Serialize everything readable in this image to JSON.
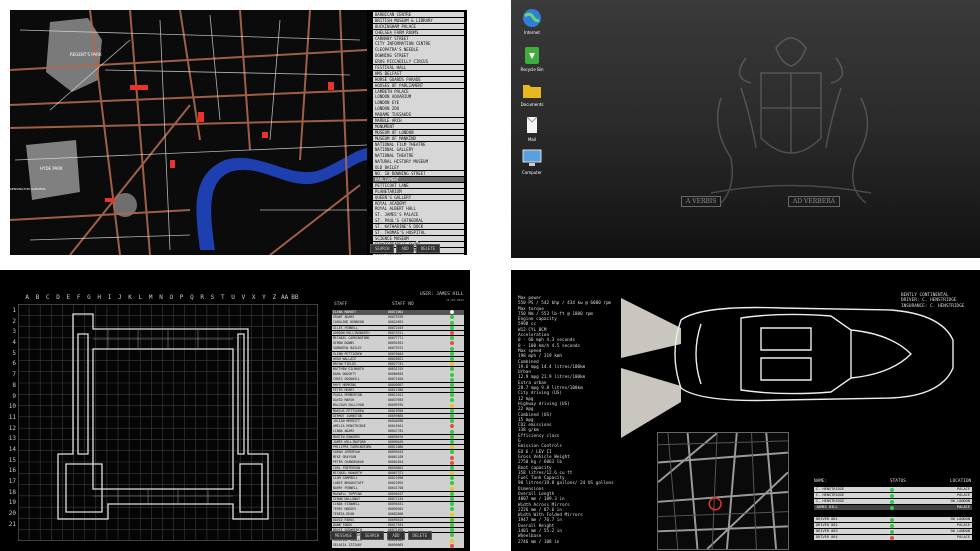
{
  "map_panel": {
    "places": [
      "BARBICAN CENTRE",
      "BRITISH MUSEUM & LIBRARY",
      "BUCKINGHAM PALACE",
      "CHELSEA FARM ROOMS",
      "CARNABY STREET",
      "CITY INFORMATION CENTRE",
      "CLEOPATRA'S NEEDLE",
      "DOWNING STREET",
      "EROS PICCADILLY CIRCUS",
      "FESTIVAL HALL",
      "HMS BELFAST",
      "HORSE GUARDS PARADE",
      "HOUSES OF PARLIAMENT",
      "LAMBETH PALACE",
      "LONDON AQUARIUM",
      "LONDON EYE",
      "LONDON ZOO",
      "MADAME TUSSAUDS",
      "MARBLE ARCH",
      "MONUMENT",
      "MUSEUM OF LONDON",
      "MUSEUM OF MANKIND",
      "NATIONAL FILM THEATRE",
      "NATIONAL GALLERY",
      "NATIONAL THEATRE",
      "NATURAL HISTORY MUSEUM",
      "OLD BAILEY",
      "NO. 10 DOWNING STREET",
      "PARLIAMENT",
      "PETTICOAT LANE",
      "PLANETARIUM",
      "QUEEN'S GALLERY",
      "ROYAL ACADEMY",
      "ROYAL ALBERT HALL",
      "ST. JAMES'S PALACE",
      "ST. PAUL'S CATHEDRAL",
      "ST. KATHARINE'S DOCK",
      "ST. THOMAS'S HOSPITAL",
      "SCIENCE MUSEUM",
      "SHAKESPEARE'S GLOBE",
      "SHERLOCK HOLMES MUSEUM",
      "SOHO SQUARE",
      "TATE GALLERY",
      "TATE MODERN",
      "THE TEMPLE",
      "TOWER BRIDGE",
      "TOWER OF LONDON",
      "TRAFALGAR SQUARE",
      "PICCADILLY CIRCUS",
      "VICTORIA & ALBERT MUSEUM",
      "WESTMINSTER ABBEY",
      "WESTMINSTER CATHEDRAL"
    ],
    "selected_index": 28,
    "buttons": {
      "search": "SEARCH",
      "add": "ADD",
      "delete": "DELETE"
    },
    "labels": {
      "regents_park": "REGENT'S PARK",
      "hyde_park": "HYDE PARK",
      "kensington": "KENSINGTON GARDENS"
    }
  },
  "desktop": {
    "icons": [
      {
        "label": "Internet",
        "icon": "globe-icon"
      },
      {
        "label": "Recycle Bin",
        "icon": "recycle-bin-icon"
      },
      {
        "label": "Documents",
        "icon": "folder-icon"
      },
      {
        "label": "Mail",
        "icon": "mail-icon"
      },
      {
        "label": "Computer",
        "icon": "monitor-icon"
      }
    ],
    "motto_left": "A VERBIS",
    "motto_right": "AD VERBERA"
  },
  "floor_plan": {
    "columns": [
      "A",
      "B",
      "C",
      "D",
      "E",
      "F",
      "G",
      "H",
      "I",
      "J",
      "K",
      "L",
      "M",
      "N",
      "O",
      "P",
      "Q",
      "R",
      "S",
      "T",
      "U",
      "V",
      "X",
      "Y",
      "Z",
      "AA",
      "BB"
    ],
    "rows": [
      "1",
      "2",
      "3",
      "4",
      "5",
      "6",
      "7",
      "8",
      "9",
      "10",
      "11",
      "12",
      "13",
      "14",
      "15",
      "16",
      "17",
      "18",
      "19",
      "20",
      "21"
    ],
    "user": "USER: JAMES HILL",
    "date": "11.05.2017",
    "staff_header": "STAFF",
    "staff_no_header": "STAFF NO",
    "staff": [
      {
        "name": "ELENA MARKET",
        "no": "00072001",
        "status": "#f2f2f2"
      },
      {
        "name": "GRANT ADAMS",
        "no": "00075376",
        "status": "#2ecc40"
      },
      {
        "name": "CAROLINE DENNSON",
        "no": "00024891",
        "status": "#2ecc40"
      },
      {
        "name": "GILES FENNELL",
        "no": "00072019",
        "status": "#2ecc40"
      },
      {
        "name": "GORDON HOLLINGWORTH",
        "no": "00073311",
        "status": "#e74c3c"
      },
      {
        "name": "MICHAEL CARRINGFORD",
        "no": "00077771",
        "status": "#2ecc40"
      },
      {
        "name": "SIMON DOWNS",
        "no": "00092651",
        "status": "#e74c3c"
      },
      {
        "name": "SAMANTHA BAILEY",
        "no": "00075372",
        "status": "#2ecc40"
      },
      {
        "name": "GLENN PETTIGREW",
        "no": "00070404",
        "status": "#2ecc40"
      },
      {
        "name": "HUGH WALLACE",
        "no": "00020021",
        "status": "#2ecc40"
      },
      {
        "name": "BRYAN FIELDS",
        "no": "00027781",
        "status": "#f1c40f"
      },
      {
        "name": "MATTHEW GILMARTH",
        "no": "00031319",
        "status": "#2ecc40"
      },
      {
        "name": "DARA DOUGHTY",
        "no": "00086655",
        "status": "#2ecc40"
      },
      {
        "name": "CHRIS GOODWILL",
        "no": "00071020",
        "status": "#2ecc40"
      },
      {
        "name": "RHYS HEMMING",
        "no": "00040097",
        "status": "#2ecc40"
      },
      {
        "name": "PETER HENRY",
        "no": "00011980",
        "status": "#2ecc40"
      },
      {
        "name": "PAULA PEMBERTON",
        "no": "00011011",
        "status": "#2ecc40"
      },
      {
        "name": "DAVID MARSH",
        "no": "00037655",
        "status": "#2ecc40"
      },
      {
        "name": "MALCOLM SULLIVAN",
        "no": "00099765",
        "status": "#f1c40f"
      },
      {
        "name": "MARCUS PETTIGREW",
        "no": "00019956",
        "status": "#2ecc40"
      },
      {
        "name": "DERMOT JOHNSTON",
        "no": "00099865",
        "status": "#2ecc40"
      },
      {
        "name": "JULIAN MERRITT",
        "no": "00040566",
        "status": "#2ecc40"
      },
      {
        "name": "AMELIA HENSTRIDGE",
        "no": "00016561",
        "status": "#e74c3c"
      },
      {
        "name": "LINDA ADAMS",
        "no": "00047781",
        "status": "#2ecc40"
      },
      {
        "name": "MARTIN EDWARDS",
        "no": "00095676",
        "status": "#2ecc40"
      },
      {
        "name": "JAMES WILLINGFORD",
        "no": "00090165",
        "status": "#2ecc40"
      },
      {
        "name": "PHILIPPA CARRINGFORD",
        "no": "00011066",
        "status": "#f1c40f"
      },
      {
        "name": "SARAH JEREMIAH",
        "no": "00099453",
        "status": "#2ecc40"
      },
      {
        "name": "MIKE GRAYSON",
        "no": "00061109",
        "status": "#e74c3c"
      },
      {
        "name": "PETER CHANDRAKAR",
        "no": "00001654",
        "status": "#e74c3c"
      },
      {
        "name": "CARL FENTERSON",
        "no": "00050801",
        "status": "#2ecc40"
      },
      {
        "name": "MICHAEL HOWARTH",
        "no": "00067371",
        "status": "#f1c40f"
      },
      {
        "name": "LIAM CAMPBELL",
        "no": "00021090",
        "status": "#2ecc40"
      },
      {
        "name": "LANCE BROOKSTAFF",
        "no": "00022092",
        "status": "#2ecc40"
      },
      {
        "name": "BARRY FENNELL",
        "no": "00041700",
        "status": "#f1c40f"
      },
      {
        "name": "MAXWELL TOPPING",
        "no": "00090107",
        "status": "#2ecc40"
      },
      {
        "name": "SIMON HOLLOWAY",
        "no": "00071155",
        "status": "#2ecc40"
      },
      {
        "name": "LINDA STANWELL",
        "no": "00094031",
        "status": "#2ecc40"
      },
      {
        "name": "TERRY HODGES",
        "no": "00090302",
        "status": "#2ecc40"
      },
      {
        "name": "TERESA DEAN",
        "no": "00082800",
        "status": "#f1c40f"
      },
      {
        "name": "DAVID PARKS",
        "no": "00095015",
        "status": "#2ecc40"
      },
      {
        "name": "DAWN TODDS",
        "no": "00017553",
        "status": "#2ecc40"
      },
      {
        "name": "BRUCE GODWRENCH",
        "no": "00071095",
        "status": "#2ecc40"
      },
      {
        "name": "CARMEL EDWARDS",
        "no": "00021057",
        "status": "#2ecc40"
      },
      {
        "name": "CAROLINE KNOLLS",
        "no": "00042043",
        "status": "#f1c40f"
      },
      {
        "name": "SELASIA IZZIARY",
        "no": "00090065",
        "status": "#e74c3c"
      }
    ],
    "selected_index": 0,
    "buttons": {
      "message": "MESSAGE",
      "search": "SEARCH",
      "add": "ADD",
      "delete": "DELETE"
    }
  },
  "car_panel": {
    "specs": [
      "Max power",
      "550 PS / 542 bhp / 434 kw @ 6000 rpm",
      "Max torque",
      "750 Nm / 553 lb-ft @ 1800 rpm",
      "Engine capacity",
      "5998 cc",
      "W12 CYL BCM",
      "Acceleration",
      "0 - 60 mph 4.3 seconds",
      "0 - 100 km/h 4.5 seconds",
      "Max speed",
      "198 mph / 319 kmh",
      "Combined",
      "19.6 mpg 14.4 litres/100km",
      "Urban",
      "12.9 mpg 21.9 litres/100km",
      "Extra urban",
      "28.7 mpg 9.8 litres/100km",
      "City driving (US)",
      "12 mpg",
      "Highway driving (US)",
      "22 mpg",
      "Combined (US)",
      "15 mpg",
      "CO2 emissions",
      "338 g/km",
      "Efficiency class",
      "G",
      "Emission Controls",
      "EU 6 / LEV II",
      "Gross Vehicle Weight",
      "2750 kg / 6063 lb",
      "Boot capacity",
      "358 litres/12.6 cu ft",
      "Fuel Tank Capacity",
      "90 litres/19.8 gallons/ 24 US gallons",
      "Dimensions",
      "Overall Length",
      "4807 mm / 189.3 in",
      "Width Across Mirrors",
      "2226 mm / 87.6 in",
      "Width With Folded Mirrors",
      "1947 mm / 76.7 in",
      "Overall Height",
      "1401 mm / 55.2 in",
      "Wheelbase",
      "2746 mm / 108 in"
    ],
    "car_info": [
      "BENTLY CONTINENTAL",
      "DRIVER: C. HENSTRIDGE",
      "INSURANCE: C. HENSTRIDGE"
    ],
    "drivers_header": {
      "name": "NAME:",
      "status": "STATUS",
      "location": "LOCATION"
    },
    "drivers": [
      {
        "name": "C. HENSTRIDGE",
        "status": "#2ecc40",
        "location": "PALACE"
      },
      {
        "name": "C. HENSTRIDGE",
        "status": "#2ecc40",
        "location": "PALACE"
      },
      {
        "name": "C. HENSTRIDGE",
        "status": "#2ecc40",
        "location": "SW LONDON"
      },
      {
        "name": "JAMES HILL",
        "status": "#2ecc40",
        "location": "PALACE"
      },
      {
        "name": "DRIVER 001",
        "status": "#2ecc40",
        "location": "SW LONDON"
      },
      {
        "name": "DRIVER 002",
        "status": "#2ecc40",
        "location": "PALACE"
      },
      {
        "name": "DRIVER 003",
        "status": "#2ecc40",
        "location": "SW LONDON"
      },
      {
        "name": "DRIVER 004",
        "status": "#e74c3c",
        "location": "PALACE"
      }
    ],
    "drivers_selected_index": 3
  }
}
